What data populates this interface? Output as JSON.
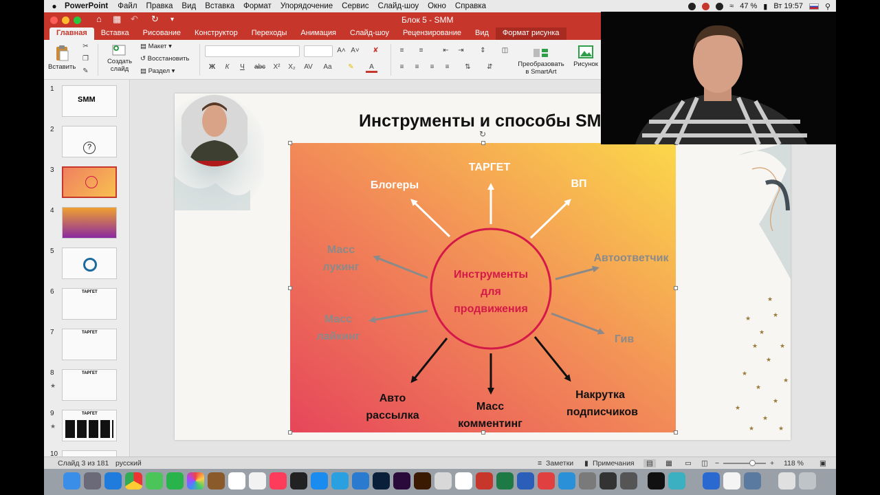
{
  "menubar": {
    "app": "PowerPoint",
    "items": [
      "Файл",
      "Правка",
      "Вид",
      "Вставка",
      "Формат",
      "Упорядочение",
      "Сервис",
      "Слайд-шоу",
      "Окно",
      "Справка"
    ],
    "battery": "47 %",
    "clock": "Вт 19:57"
  },
  "window": {
    "title": "Блок 5 - SMM"
  },
  "tabs": [
    "Главная",
    "Вставка",
    "Рисование",
    "Конструктор",
    "Переходы",
    "Анимация",
    "Слайд-шоу",
    "Рецензирование",
    "Вид",
    "Формат рисунка"
  ],
  "ribbon": {
    "paste": "Вставить",
    "create_slide_1": "Создать",
    "create_slide_2": "слайд",
    "layout": "Макет",
    "reset": "Восстановить",
    "section": "Раздел",
    "bold": "Ж",
    "italic": "К",
    "underline": "Ч",
    "strike": "abc",
    "superscript": "X²",
    "subscript": "X₂",
    "smartart_1": "Преобразовать",
    "smartart_2": "в SmartArt",
    "picture": "Рисунок"
  },
  "thumbnails": [
    {
      "num": "1",
      "star": false,
      "label": "SMM"
    },
    {
      "num": "2",
      "star": false,
      "label": ""
    },
    {
      "num": "3",
      "star": false,
      "label": ""
    },
    {
      "num": "4",
      "star": false,
      "label": ""
    },
    {
      "num": "5",
      "star": false,
      "label": ""
    },
    {
      "num": "6",
      "star": false,
      "label": "ТАРГЕТ"
    },
    {
      "num": "7",
      "star": false,
      "label": "ТАРГЕТ"
    },
    {
      "num": "8",
      "star": true,
      "label": "ТАРГЕТ"
    },
    {
      "num": "9",
      "star": true,
      "label": "ТАРГЕТ"
    },
    {
      "num": "10",
      "star": false,
      "label": ""
    }
  ],
  "slide": {
    "title": "Инструменты и способы SM",
    "center_1": "Инструменты",
    "center_2": "для",
    "center_3": "продвижения",
    "targets": "ТАРГЕТ",
    "bloggers": "Блогеры",
    "vp": "ВП",
    "mass_looking_1": "Масс",
    "mass_looking_2": "лукинг",
    "autoresponder": "Автоответчик",
    "mass_liking_1": "Масс",
    "mass_liking_2": "лайкинг",
    "giveaway": "Гив",
    "auto_mail_1": "Авто",
    "auto_mail_2": "рассылка",
    "mass_comment_1": "Масс",
    "mass_comment_2": "комментинг",
    "subs_1": "Накрутка",
    "subs_2": "подписчиков"
  },
  "status": {
    "slide_counter": "Слайд 3 из 181",
    "language": "русский",
    "notes": "Заметки",
    "comments": "Примечания",
    "zoom": "118 %"
  },
  "colors": {
    "accent": "#c7362b",
    "ring": "#d41848",
    "gray_label": "#8a8a8a"
  }
}
